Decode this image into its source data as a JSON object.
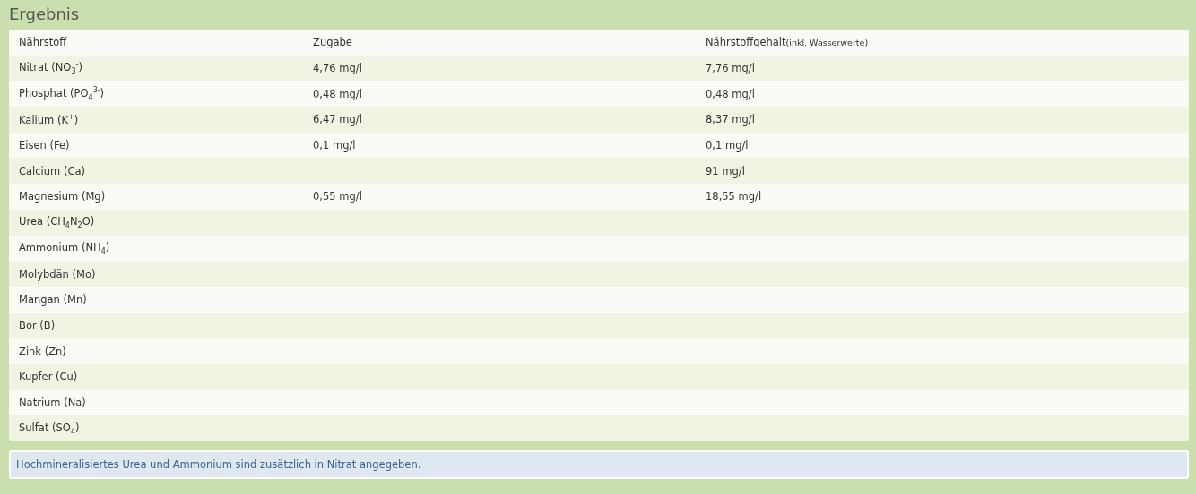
{
  "heading": "Ergebnis",
  "table": {
    "columns": [
      {
        "label": "Nährstoff"
      },
      {
        "label": "Zugabe"
      },
      {
        "label": "Nährstoffgehalt",
        "note": "(inkl. Wasserwerte)"
      }
    ],
    "rows": [
      {
        "nutrient": "Nitrat (NO$_{3}$$^{-}$)",
        "added": "4,76 mg/l",
        "content": "7,76 mg/l"
      },
      {
        "nutrient": "Phosphat (PO$_{4}$$^{3-}$)",
        "added": "0,48 mg/l",
        "content": "0,48 mg/l"
      },
      {
        "nutrient": "Kalium (K$^{+}$)",
        "added": "6,47 mg/l",
        "content": "8,37 mg/l"
      },
      {
        "nutrient": "Eisen (Fe)",
        "added": "0,1 mg/l",
        "content": "0,1 mg/l"
      },
      {
        "nutrient": "Calcium (Ca)",
        "content": "91 mg/l"
      },
      {
        "nutrient": "Magnesium (Mg)",
        "added": "0,55 mg/l",
        "content": "18,55 mg/l"
      },
      {
        "nutrient": "Urea (CH$_{4}$N$_{2}$O)"
      },
      {
        "nutrient": "Ammonium (NH$_{4}$)"
      },
      {
        "nutrient": "Molybdän (Mo)"
      },
      {
        "nutrient": "Mangan (Mn)"
      },
      {
        "nutrient": "Bor (B)"
      },
      {
        "nutrient": "Zink (Zn)"
      },
      {
        "nutrient": "Kupfer (Cu)"
      },
      {
        "nutrient": "Natrium (Na)"
      },
      {
        "nutrient": "Sulfat (SO$_{4}$)"
      }
    ]
  },
  "note": "Hochmineralisiertes Urea und Ammonium sind zusätzlich in Nitrat angegeben."
}
